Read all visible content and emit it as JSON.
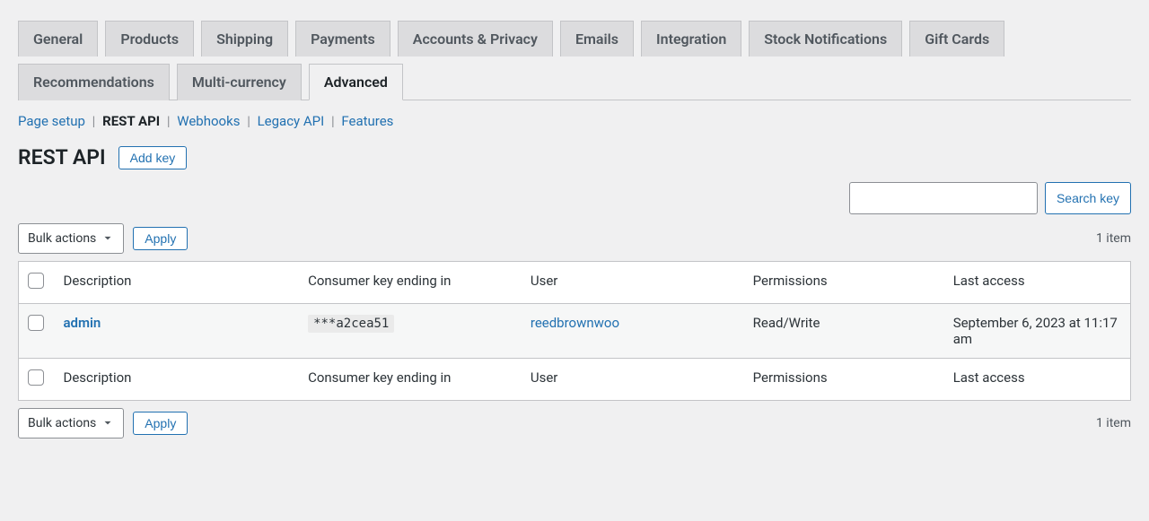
{
  "tabs": {
    "general": "General",
    "products": "Products",
    "shipping": "Shipping",
    "payments": "Payments",
    "accounts": "Accounts & Privacy",
    "emails": "Emails",
    "integration": "Integration",
    "stock": "Stock Notifications",
    "giftcards": "Gift Cards",
    "recommendations": "Recommendations",
    "multicurrency": "Multi-currency",
    "advanced": "Advanced"
  },
  "subnav": {
    "page_setup": "Page setup",
    "rest_api": "REST API",
    "webhooks": "Webhooks",
    "legacy_api": "Legacy API",
    "features": "Features"
  },
  "heading": "REST API",
  "add_key_label": "Add key",
  "search": {
    "value": "",
    "button": "Search key"
  },
  "bulk": {
    "label": "Bulk actions",
    "apply": "Apply"
  },
  "item_count": "1 item",
  "table": {
    "headers": {
      "description": "Description",
      "consumer_key": "Consumer key ending in",
      "user": "User",
      "permissions": "Permissions",
      "last_access": "Last access"
    },
    "rows": [
      {
        "description": "admin",
        "consumer_key": "***a2cea51",
        "user": "reedbrownwoo",
        "permissions": "Read/Write",
        "last_access": "September 6, 2023 at 11:17 am"
      }
    ]
  }
}
